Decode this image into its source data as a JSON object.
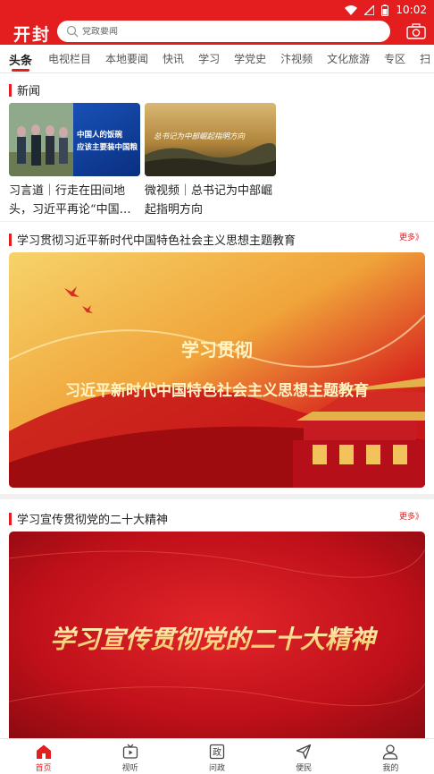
{
  "status_bar": {
    "time": "10:02"
  },
  "header": {
    "logo": "开封",
    "search_placeholder": "党政要闻",
    "icons": [
      "search-icon",
      "camera-icon",
      "wifi-icon",
      "signal-icon",
      "battery-icon"
    ],
    "accent_color": "#e41e1e"
  },
  "tabs": [
    "头条",
    "电视栏目",
    "本地要闻",
    "快讯",
    "学习",
    "学党史",
    "汴视频",
    "文化旅游",
    "专区",
    "扫"
  ],
  "news": {
    "title": "新闻",
    "cards": [
      {
        "caption": "习言道｜行走在田间地头，习近平再论“中国…",
        "thumb_text": "中国人的饭碗\n应该主要装中国粮"
      },
      {
        "caption": "微视频｜总书记为中部崛起指明方向",
        "thumb_text": "总书记为中部崛起指明方向"
      }
    ]
  },
  "section1": {
    "title": "学习贯彻习近平新时代中国特色社会主义思想主题教育",
    "more": "更多》",
    "banner_line1": "学习贯彻",
    "banner_line2": "习近平新时代中国特色社会主义思想主题教育"
  },
  "section2": {
    "title": "学习宣传贯彻党的二十大精神",
    "more": "更多》",
    "banner_text": "学习宣传贯彻党的二十大精神"
  },
  "bottom_nav": [
    {
      "label": "首页",
      "icon": "home-icon",
      "active": true
    },
    {
      "label": "视听",
      "icon": "tv-icon",
      "active": false
    },
    {
      "label": "问政",
      "icon": "politics-icon",
      "active": false
    },
    {
      "label": "便民",
      "icon": "send-icon",
      "active": false
    },
    {
      "label": "我的",
      "icon": "user-icon",
      "active": false
    }
  ]
}
